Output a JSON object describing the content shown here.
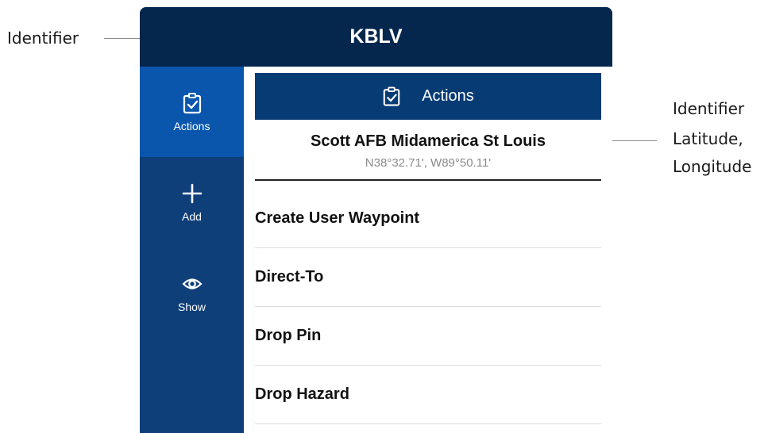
{
  "callouts": {
    "identifier_left": "Identifier",
    "right_lines": [
      "Identifier",
      "Latitude,",
      "Longitude"
    ]
  },
  "header": {
    "title": "KBLV"
  },
  "sidebar": {
    "items": [
      {
        "label": "Actions",
        "icon": "clipboard-check-icon",
        "active": true
      },
      {
        "label": "Add",
        "icon": "plus-icon",
        "active": false
      },
      {
        "label": "Show",
        "icon": "eye-icon",
        "active": false
      }
    ]
  },
  "actions_bar": {
    "label": "Actions",
    "icon": "clipboard-check-icon"
  },
  "location": {
    "name": "Scott AFB Midamerica St Louis",
    "coordinates": "N38°32.71',  W89°50.11'"
  },
  "menu": {
    "items": [
      "Create User Waypoint",
      "Direct-To",
      "Drop Pin",
      "Drop Hazard"
    ]
  },
  "colors": {
    "header_bg": "#05274d",
    "sidebar_bg": "#0e3f79",
    "sidebar_active": "#0a56ad",
    "actions_bar_bg": "#063b74"
  }
}
